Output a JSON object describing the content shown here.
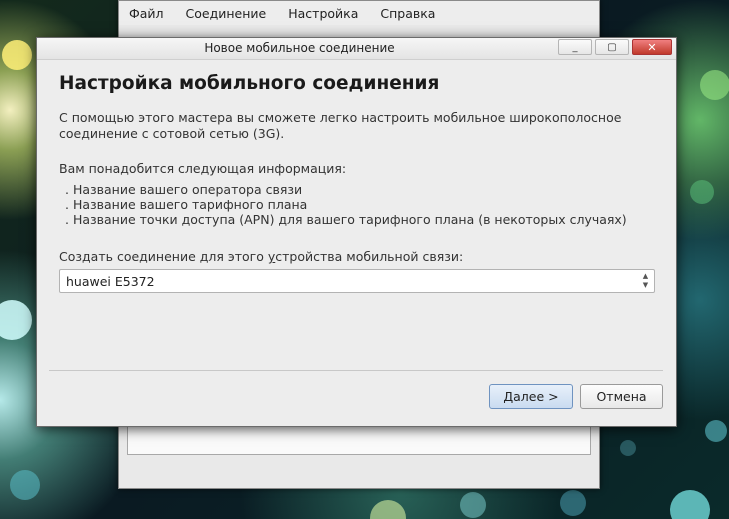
{
  "background_window": {
    "menu": [
      "Файл",
      "Соединение",
      "Настройка",
      "Справка"
    ]
  },
  "dialog": {
    "title": "Новое мобильное соединение",
    "heading": "Настройка мобильного соединения",
    "intro_line1": "С помощью этого мастера вы сможете легко настроить мобильное широкополосное",
    "intro_line2": "соединение с сотовой сетью (3G).",
    "info_header": "Вам понадобится следующая информация:",
    "info_items": [
      ". Название вашего оператора связи",
      ". Название вашего тарифного плана",
      ". Название точки доступа (APN) для вашего тарифного плана (в некоторых случаях)"
    ],
    "device_label_pre": "Создать соединение для этого ",
    "device_label_mnemonic": "у",
    "device_label_post": "стройства мобильной связи:",
    "device_selected": "huawei E5372",
    "next_mnemonic": "Д",
    "next_rest": "алее >",
    "cancel_label": "Отмена",
    "close_glyph": "✕",
    "maximize_glyph": "▢",
    "minimize_glyph": "_"
  },
  "colors": {
    "close_button": "#c0392b",
    "default_button": "#c9dbf0"
  }
}
